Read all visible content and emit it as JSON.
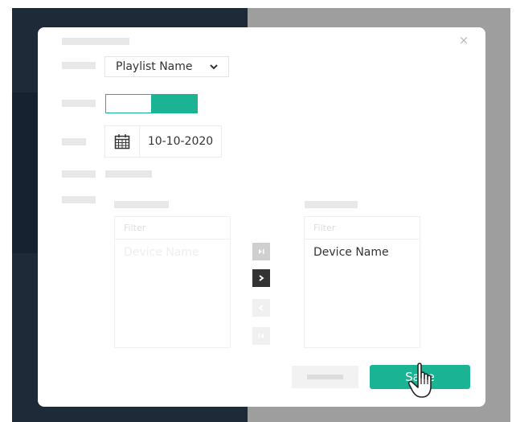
{
  "dialog": {
    "close_glyph": "×",
    "playlist_select": {
      "value": "Playlist Name"
    },
    "toggle": {
      "state": "on",
      "accent": "#1ab394"
    },
    "date": {
      "value": "10-10-2020",
      "icon": "calendar-icon"
    },
    "available": {
      "filter_placeholder": "Filter",
      "items": [
        "Device Name"
      ]
    },
    "selected": {
      "filter_placeholder": "Filter",
      "items": [
        "Device Name"
      ]
    },
    "move_buttons": [
      {
        "glyph": "⏭",
        "icon": "move-all-right-icon",
        "enabled": false
      },
      {
        "glyph": "›",
        "icon": "move-right-icon",
        "enabled": true
      },
      {
        "glyph": "‹",
        "icon": "move-left-icon",
        "enabled": false
      },
      {
        "glyph": "⏮",
        "icon": "move-all-left-icon",
        "enabled": false
      }
    ],
    "save_label": "Save",
    "colors": {
      "accent": "#1ab394",
      "backdrop_dark": "#1f2a38",
      "backdrop_gray": "#9e9e9e"
    }
  }
}
